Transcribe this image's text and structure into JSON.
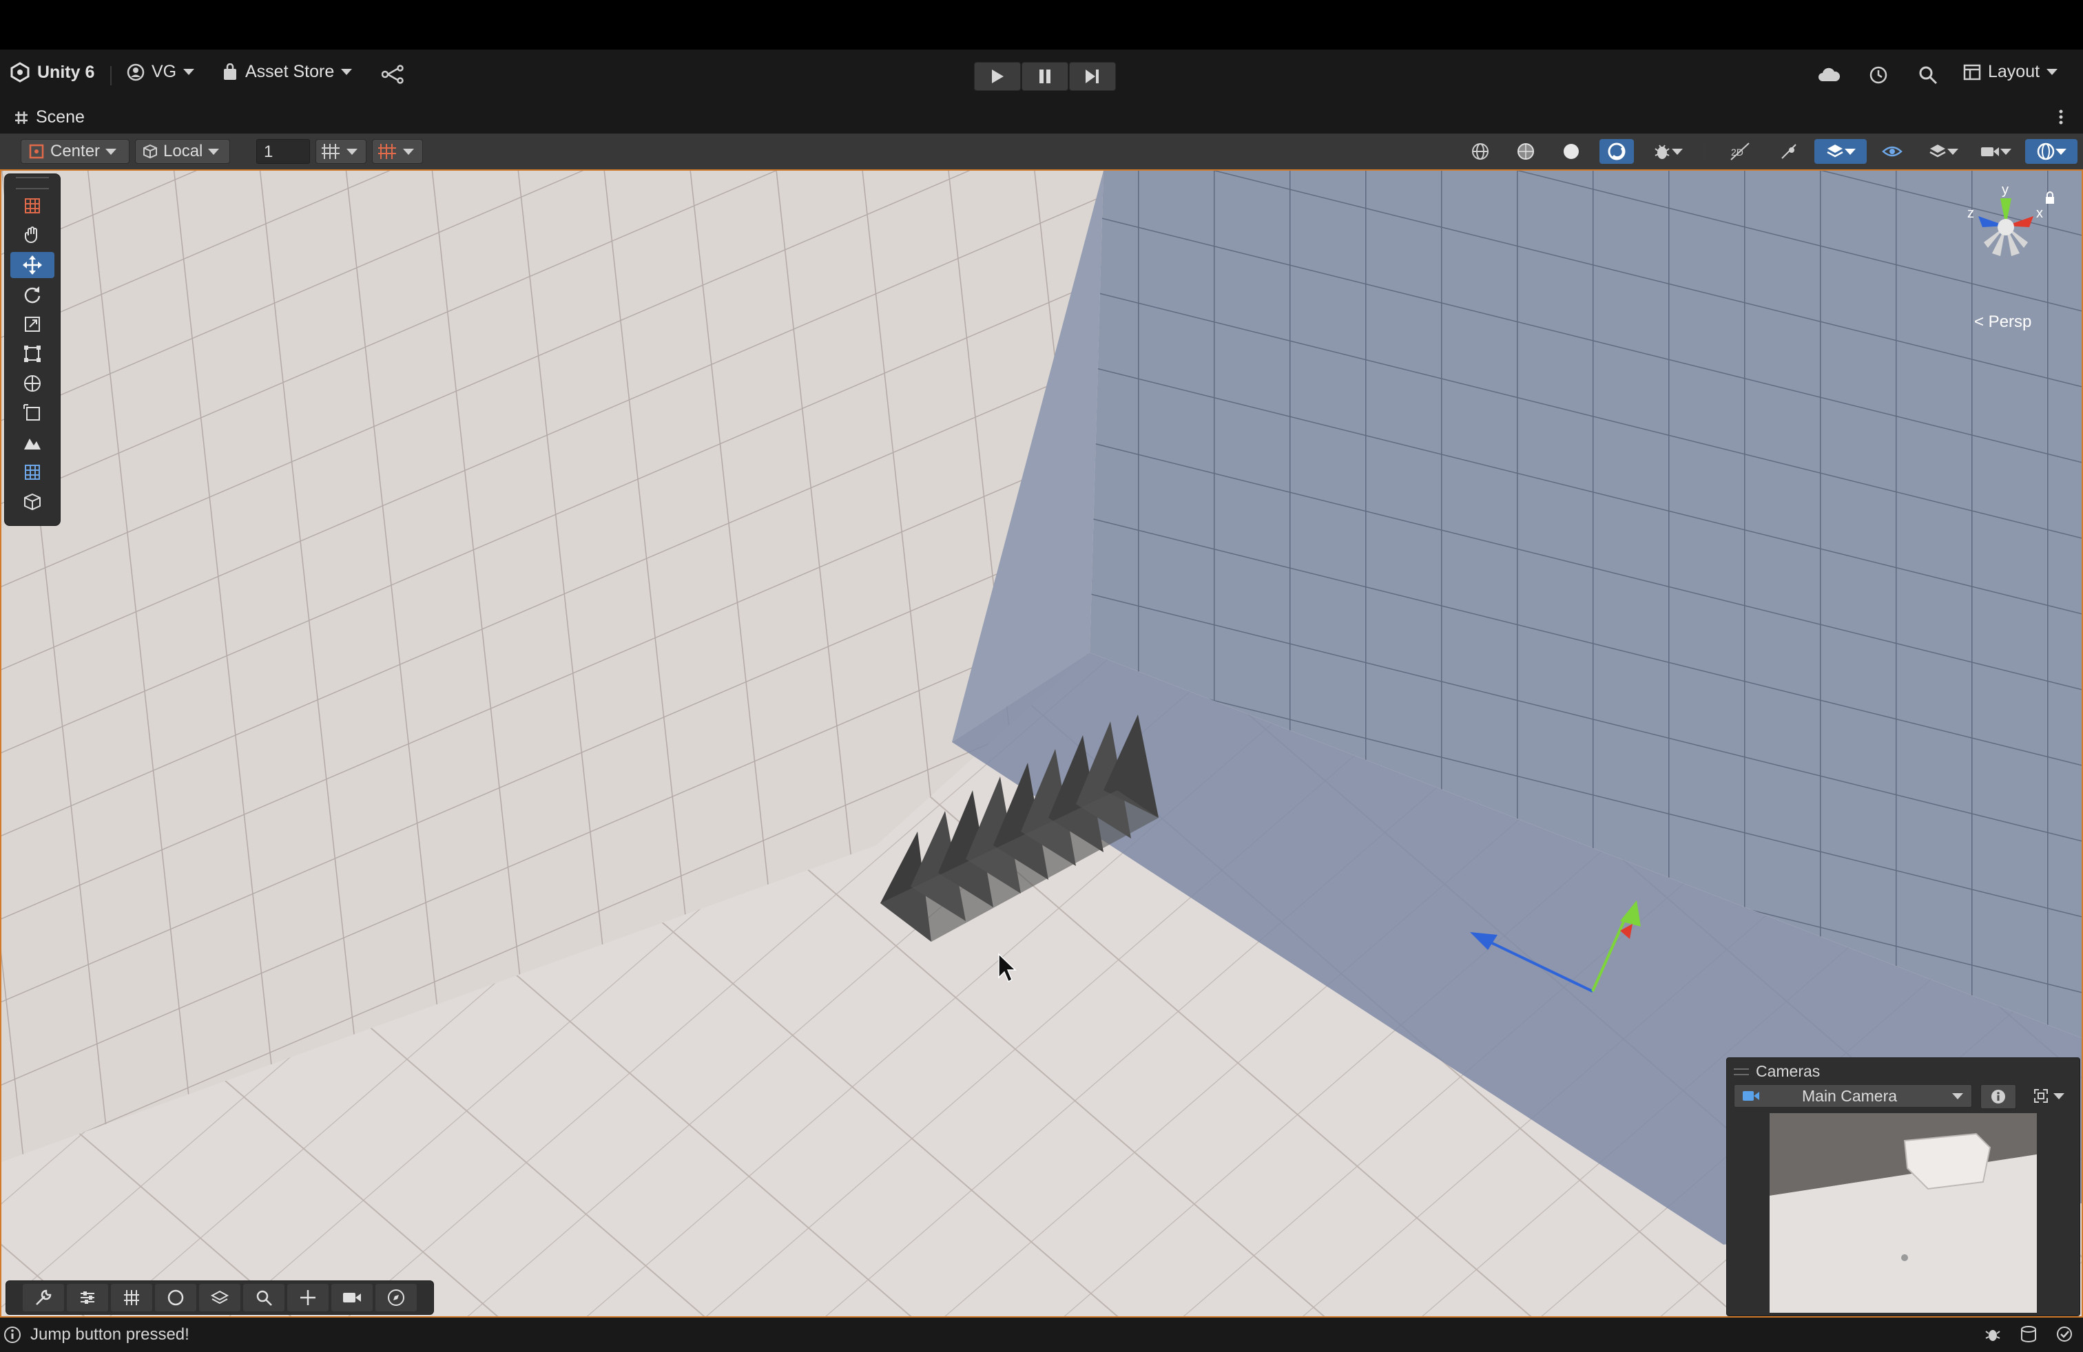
{
  "main_toolbar": {
    "app_label": "Unity 6",
    "account_label": "VG",
    "asset_store_label": "Asset Store",
    "layout_label": "Layout"
  },
  "tab": {
    "label": "Scene"
  },
  "scene_toolbar": {
    "pivot_label": "Center",
    "space_label": "Local",
    "grid_snap_value": "1"
  },
  "scene_view": {
    "projection_label": "< Persp",
    "gizmo_axes": {
      "x": "x",
      "y": "y",
      "z": "z"
    }
  },
  "cameras_overlay": {
    "title": "Cameras",
    "selected_camera": "Main Camera"
  },
  "status_bar": {
    "message": "Jump button pressed!"
  },
  "colors": {
    "accent_blue": "#3a6aa3",
    "scene_border": "#d27a2b",
    "axis_x": "#e03a2c",
    "axis_y": "#7dd43b",
    "axis_z": "#2f64d8"
  }
}
